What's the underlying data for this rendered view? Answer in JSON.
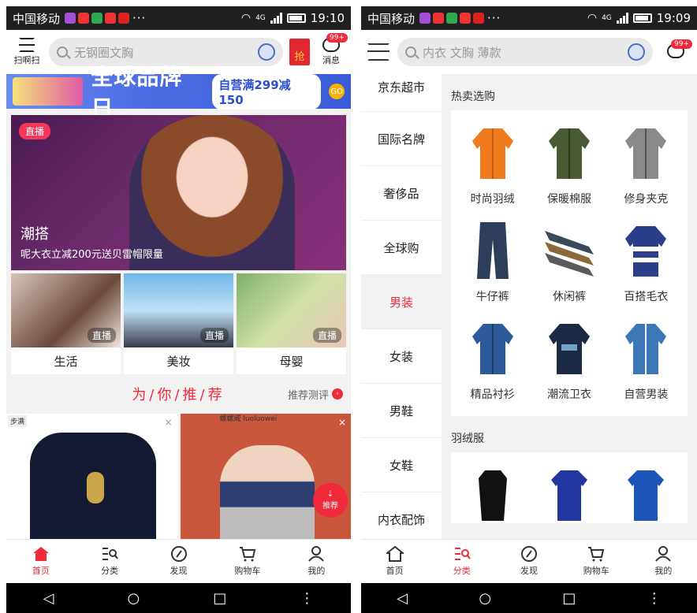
{
  "statusbar_left": {
    "carrier": "中国移动",
    "dots": "···",
    "network": "4G",
    "time": "19:10"
  },
  "statusbar_right": {
    "carrier": "中国移动",
    "dots": "···",
    "network": "4G",
    "time": "19:09"
  },
  "colors": {
    "accent": "#f2293a",
    "banner_blue": "#4c6de3",
    "promo_gold": "#f5b400"
  },
  "home": {
    "scan_label": "扫啊扫",
    "search_placeholder": "无钢圈文胸",
    "qiang_label": "抢",
    "message_label": "消息",
    "message_badge": "99+",
    "banner": {
      "title": "全球品牌日",
      "promo": "自营满299减150",
      "go": "GO"
    },
    "live": {
      "tag": "直播",
      "title": "潮搭",
      "subtitle": "呢大衣立减200元送贝雷帽限量"
    },
    "sub_lives": [
      {
        "label": "生活",
        "tag": "直播"
      },
      {
        "label": "美妆",
        "tag": "直播"
      },
      {
        "label": "母婴",
        "tag": "直播"
      }
    ],
    "recommend": {
      "title": "为/你/推/荐",
      "eval": "推荐测评"
    },
    "products": [
      {
        "brand": "步满",
        "close": "×"
      },
      {
        "brand": "螺螺威 luoluowei",
        "close": "×"
      }
    ],
    "float_recommend": "推荐",
    "tabs": [
      {
        "label": "首页",
        "icon": "home-icon"
      },
      {
        "label": "分类",
        "icon": "category-icon"
      },
      {
        "label": "发现",
        "icon": "compass-icon"
      },
      {
        "label": "购物车",
        "icon": "cart-icon"
      },
      {
        "label": "我的",
        "icon": "user-icon"
      }
    ]
  },
  "category": {
    "search_placeholder": "内衣 文胸 薄款",
    "message_badge": "99+",
    "sidebar": [
      "京东超市",
      "国际名牌",
      "奢侈品",
      "全球购",
      "男装",
      "女装",
      "男鞋",
      "女鞋",
      "内衣配饰"
    ],
    "active_index": 4,
    "section1_title": "热卖选购",
    "section1_items": [
      "时尚羽绒",
      "保暖棉服",
      "修身夹克",
      "牛仔裤",
      "休闲裤",
      "百搭毛衣",
      "精品衬衫",
      "潮流卫衣",
      "自营男装"
    ],
    "section2_title": "羽绒服",
    "tabs": [
      {
        "label": "首页",
        "icon": "home-icon"
      },
      {
        "label": "分类",
        "icon": "category-icon"
      },
      {
        "label": "发现",
        "icon": "compass-icon"
      },
      {
        "label": "购物车",
        "icon": "cart-icon"
      },
      {
        "label": "我的",
        "icon": "user-icon"
      }
    ]
  }
}
